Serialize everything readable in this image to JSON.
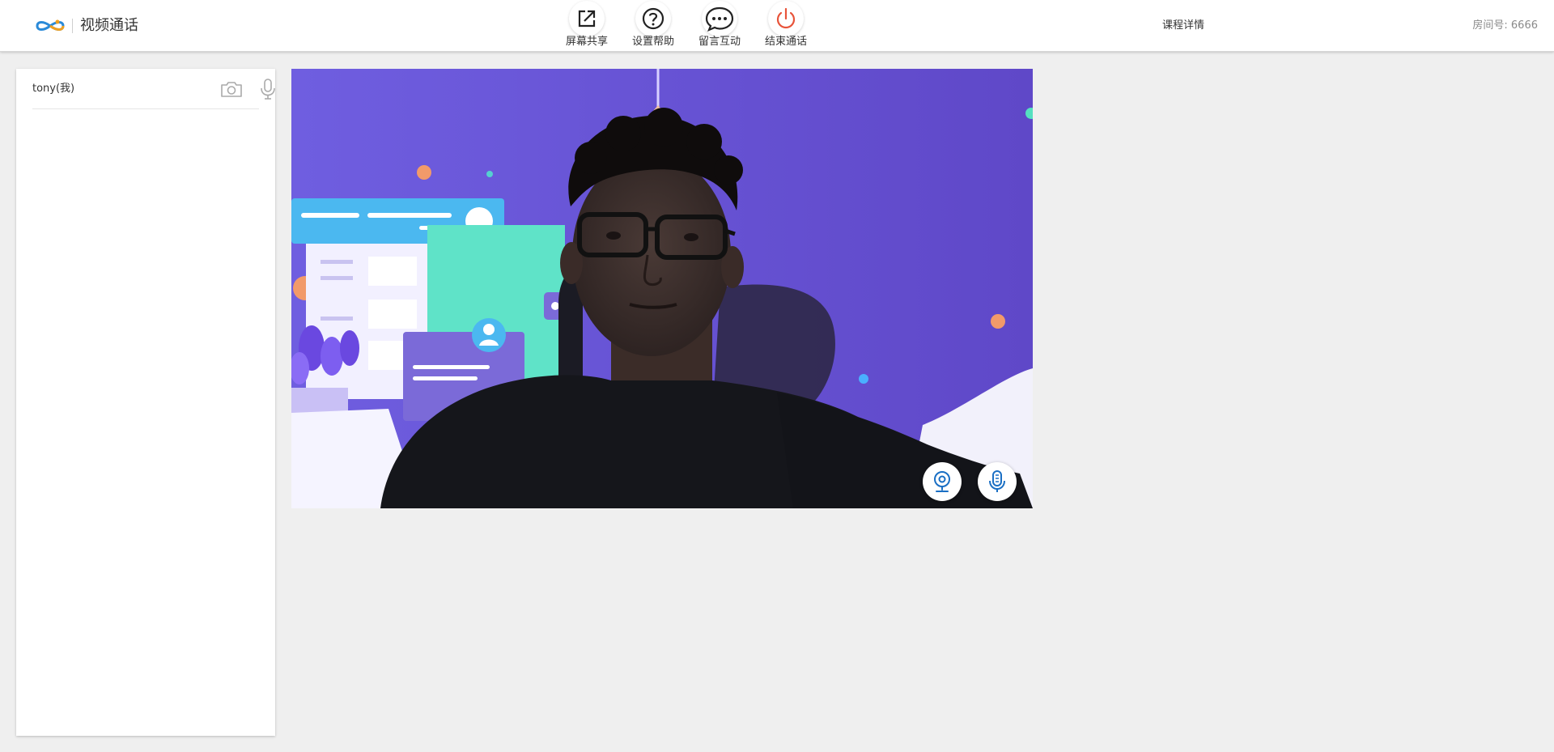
{
  "app": {
    "title": "视频通话"
  },
  "toolbar": {
    "items": [
      {
        "label": "屏幕共享",
        "icon": "share-icon"
      },
      {
        "label": "设置帮助",
        "icon": "help-icon"
      },
      {
        "label": "留言互动",
        "icon": "chat-icon"
      },
      {
        "label": "结束通话",
        "icon": "power-icon"
      }
    ]
  },
  "header": {
    "course_detail": "课程详情",
    "room_number": "房间号: 6666"
  },
  "members": [
    {
      "name": "tony(我)",
      "camera_icon": "camera-icon",
      "mic_icon": "microphone-icon"
    }
  ],
  "video_controls": {
    "camera_icon": "webcam-icon",
    "mic_icon": "microphone-icon"
  },
  "colors": {
    "accent_blue": "#1a6fc4",
    "end_call_red": "#e8543a",
    "video_background": "#6b56d8",
    "page_background": "#efefef"
  }
}
